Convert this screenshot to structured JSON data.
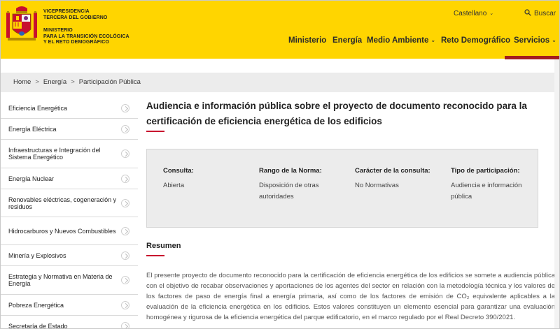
{
  "header": {
    "gov_line1": "VICEPRESIDENCIA",
    "gov_line2": "TERCERA DEL GOBIERNO",
    "ministry_line1": "MINISTERIO",
    "ministry_line2": "PARA LA TRANSICIÓN ECOLÓGICA",
    "ministry_line3": "Y EL RETO DEMOGRÁFICO",
    "language": "Castellano",
    "search_label": "Buscar",
    "nav": [
      "Ministerio",
      "Energía",
      "Medio Ambiente",
      "Reto Demográfico",
      "Servicios"
    ],
    "accent_color": "#ffd500",
    "red_color": "#a41d1d"
  },
  "breadcrumb": [
    "Home",
    "Energía",
    "Participación Pública"
  ],
  "sidebar": {
    "items": [
      {
        "label": "Eficiencia Energética"
      },
      {
        "label": "Energía Eléctrica"
      },
      {
        "label": "Infraestructuras e Integración del Sistema Energético"
      },
      {
        "label": "Energía Nuclear"
      },
      {
        "label": "Renovables eléctricas, cogeneración y residuos"
      },
      {
        "label": "Hidrocarburos y Nuevos Combustibles"
      },
      {
        "label": "Minería y Explosivos"
      },
      {
        "label": "Estrategia y Normativa en Materia de Energía"
      },
      {
        "label": "Pobreza Energética"
      },
      {
        "label": "Secretaría de Estado"
      }
    ]
  },
  "main": {
    "title": "Audiencia e información pública sobre el proyecto de documento reconocido para la certificación de eficiencia energética de los edificios",
    "info": [
      {
        "label": "Consulta:",
        "value": "Abierta"
      },
      {
        "label": "Rango de la Norma:",
        "value": "Disposición de otras autoridades"
      },
      {
        "label": "Carácter de la consulta:",
        "value": "No Normativas"
      },
      {
        "label": "Tipo de participación:",
        "value": "Audiencia e información pública"
      }
    ],
    "resumen_heading": "Resumen",
    "summary": "El presente proyecto de documento reconocido para la certificación de eficiencia energética de los edificios se somete a audiencia pública con el objetivo de recabar observaciones y aportaciones de los agentes del sector en relación con la metodología técnica y los valores de los factores de paso de energía final a energía primaria, así como de los factores de emisión de CO₂ equivalente aplicables a la evaluación de la eficiencia energética en los edificios. Estos valores constituyen un elemento esencial para garantizar una evaluación homogénea y rigurosa de la eficiencia energética del parque edificatorio, en el marco regulado por el Real Decreto 390/2021."
  }
}
